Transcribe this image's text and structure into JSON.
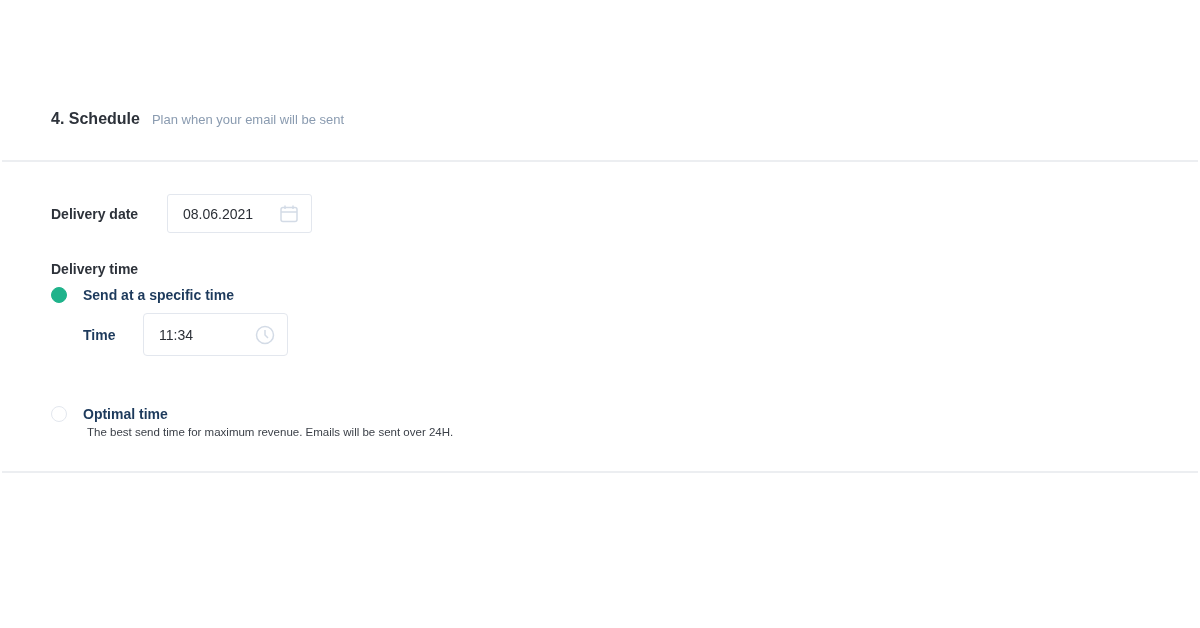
{
  "section": {
    "title": "4. Schedule",
    "subtitle": "Plan when your email will be sent"
  },
  "delivery_date": {
    "label": "Delivery date",
    "value": "08.06.2021"
  },
  "delivery_time": {
    "label": "Delivery time",
    "options": [
      {
        "label": "Send at a specific time",
        "selected": true,
        "time_field": {
          "label": "Time",
          "value": "11:34"
        }
      },
      {
        "label": "Optimal time",
        "selected": false,
        "description": "The best send time for maximum revenue. Emails will be sent over 24H."
      }
    ]
  }
}
